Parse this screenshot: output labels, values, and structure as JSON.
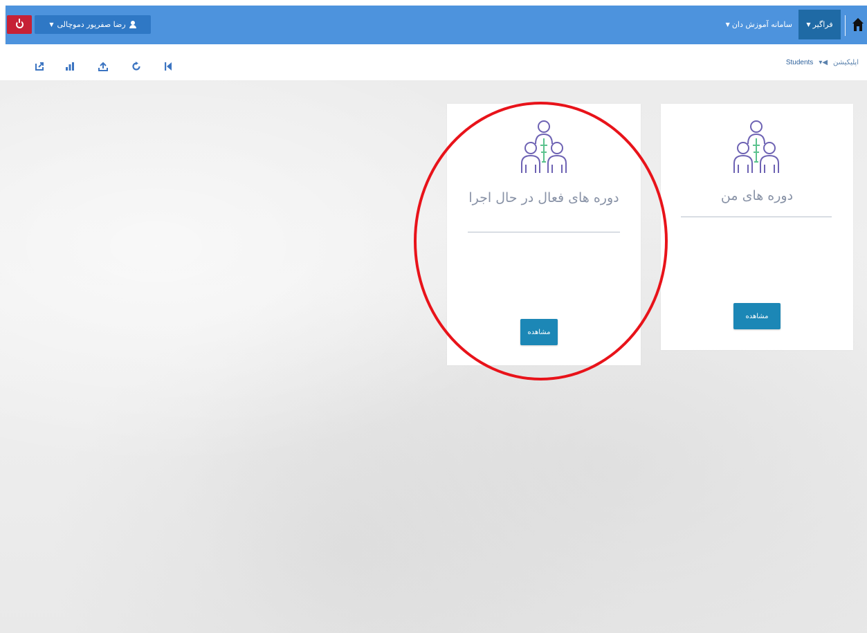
{
  "navbar": {
    "user_name": "رضا صفرپور دموچالی",
    "student_menu": "فراگیر",
    "system_menu": "سامانه آموزش دان"
  },
  "breadcrumb": {
    "app": "اپلیکیشن",
    "current": "Students"
  },
  "cards": [
    {
      "title": "دوره های من",
      "button": "مشاهده"
    },
    {
      "title": "دوره های فعال در حال اجرا",
      "button": "مشاهده"
    }
  ],
  "colors": {
    "navbar": "#4d93dd",
    "user_button": "#2f78c5",
    "student_button": "#1f6aa5",
    "power_button": "#c62136",
    "view_button": "#1c87b6",
    "highlight": "#e8131a"
  },
  "icons": [
    "power-icon",
    "user-icon",
    "home-icon",
    "group-icon",
    "export-icon",
    "chart-icon",
    "upload-icon",
    "refresh-icon",
    "first-page-icon"
  ]
}
